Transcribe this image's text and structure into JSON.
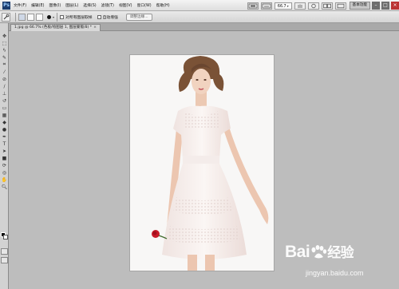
{
  "menubar": {
    "logo": "Ps",
    "items": [
      "文件(F)",
      "编辑(E)",
      "图像(I)",
      "图层(L)",
      "选择(S)",
      "滤镜(T)",
      "视图(V)",
      "窗口(W)",
      "帮助(H)"
    ],
    "zoom": "66.7",
    "workspace": "基本功能"
  },
  "options": {
    "sample_all_layers": "对所有图层取样",
    "auto_enhance": "自动增强",
    "refine_edge": "调整边缘..."
  },
  "document": {
    "tab_title": "1.jpg @ 66.7% (色板/绘图层 1, 图层蒙版/8) *"
  },
  "watermark": {
    "logo_left": "Bai",
    "logo_right": "经验",
    "url": "jingyan.baidu.com"
  },
  "colors": {
    "foreground": "#000000",
    "background": "#ffffff"
  }
}
